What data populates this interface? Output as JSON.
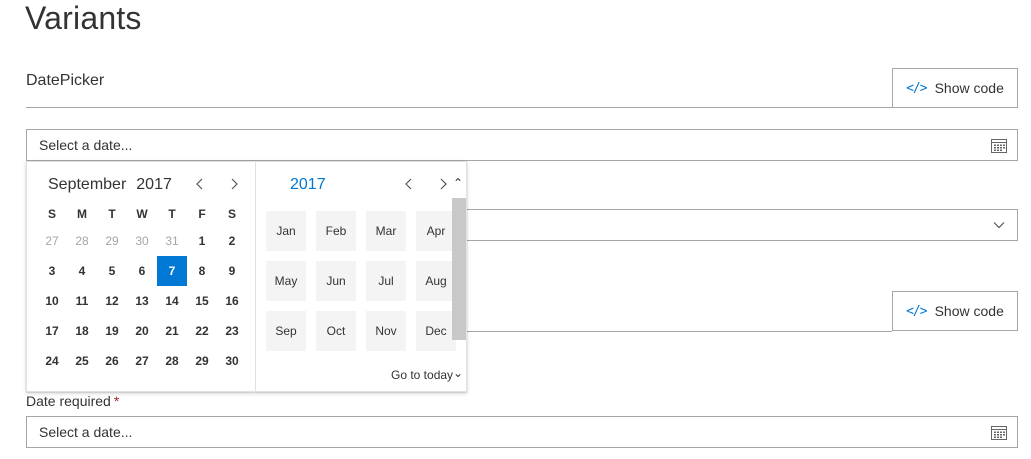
{
  "page": {
    "title": "Variants"
  },
  "section1": {
    "title": "DatePicker",
    "show_code_label": "Show code",
    "date_field": {
      "placeholder": "Select a date...",
      "icon": "calendar-icon"
    }
  },
  "section2": {
    "show_code_label": "Show code",
    "dropdown_icon": "chevron-down-icon"
  },
  "section3": {
    "label": "Date required",
    "required_mark": "*",
    "date_field": {
      "placeholder": "Select a date...",
      "icon": "calendar-icon"
    }
  },
  "calendar": {
    "month": "September",
    "year": "2017",
    "prev_icon": "chevron-left-icon",
    "next_icon": "chevron-right-icon",
    "weekdays": [
      "S",
      "M",
      "T",
      "W",
      "T",
      "F",
      "S"
    ],
    "weeks": [
      [
        {
          "d": "27",
          "out": true
        },
        {
          "d": "28",
          "out": true
        },
        {
          "d": "29",
          "out": true
        },
        {
          "d": "30",
          "out": true
        },
        {
          "d": "31",
          "out": true
        },
        {
          "d": "1"
        },
        {
          "d": "2"
        }
      ],
      [
        {
          "d": "3"
        },
        {
          "d": "4"
        },
        {
          "d": "5"
        },
        {
          "d": "6"
        },
        {
          "d": "7",
          "selected": true
        },
        {
          "d": "8"
        },
        {
          "d": "9"
        }
      ],
      [
        {
          "d": "10"
        },
        {
          "d": "11"
        },
        {
          "d": "12"
        },
        {
          "d": "13"
        },
        {
          "d": "14"
        },
        {
          "d": "15"
        },
        {
          "d": "16"
        }
      ],
      [
        {
          "d": "17"
        },
        {
          "d": "18"
        },
        {
          "d": "19"
        },
        {
          "d": "20"
        },
        {
          "d": "21"
        },
        {
          "d": "22"
        },
        {
          "d": "23"
        }
      ],
      [
        {
          "d": "24"
        },
        {
          "d": "25"
        },
        {
          "d": "26"
        },
        {
          "d": "27"
        },
        {
          "d": "28"
        },
        {
          "d": "29"
        },
        {
          "d": "30"
        }
      ]
    ],
    "month_picker": {
      "year": "2017",
      "months": [
        "Jan",
        "Feb",
        "Mar",
        "Apr",
        "May",
        "Jun",
        "Jul",
        "Aug",
        "Sep",
        "Oct",
        "Nov",
        "Dec"
      ],
      "go_to_today": "Go to today"
    }
  },
  "colors": {
    "accent": "#0078d4",
    "required": "#a4262c",
    "border": "#a6a6a6",
    "cell_bg": "#f4f4f4"
  }
}
